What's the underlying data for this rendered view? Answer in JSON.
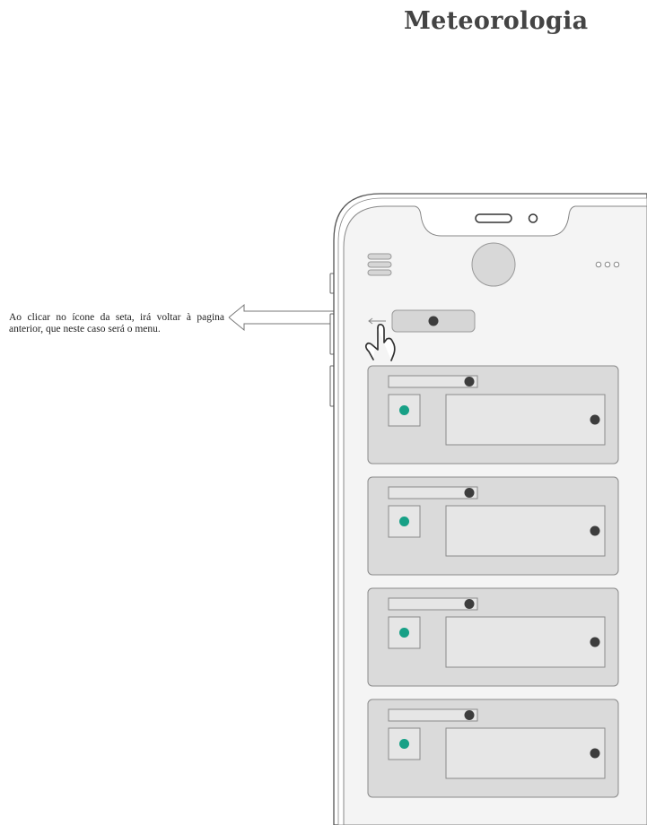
{
  "page": {
    "title": "Meteorologia"
  },
  "annotation": {
    "text": "Ao clicar no ícone da seta, irá voltar à pagina anterior, que neste caso será o menu."
  },
  "colors": {
    "accent_dot": "#17a086",
    "placeholder_dot": "#3d3d3d",
    "card_fill": "#dadada",
    "screen_fill": "#f4f4f4",
    "outline": "#8a8a8a"
  },
  "phone": {
    "header_icons": [
      "menu-icon",
      "avatar",
      "more-icon"
    ],
    "back_icon": "arrow-left-icon",
    "gesture_icon": "hand-pointer-icon",
    "cards": [
      {
        "id": 1
      },
      {
        "id": 2
      },
      {
        "id": 3
      },
      {
        "id": 4
      }
    ]
  }
}
